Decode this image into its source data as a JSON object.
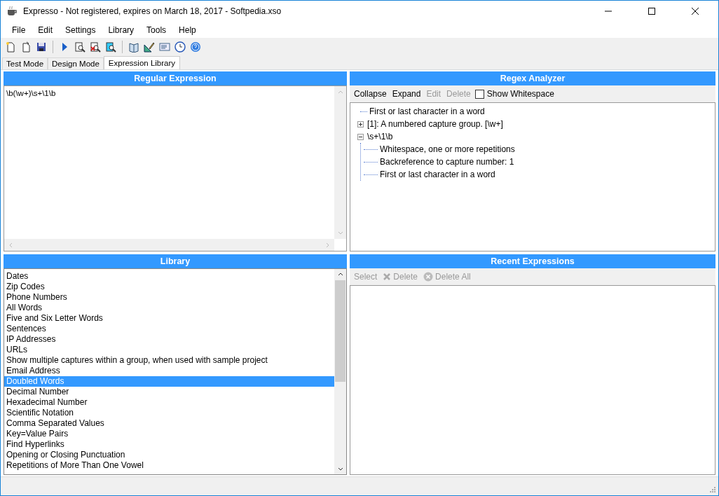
{
  "window": {
    "title": "Expresso - Not registered, expires on March 18, 2017 - Softpedia.xso"
  },
  "menu": [
    "File",
    "Edit",
    "Settings",
    "Library",
    "Tools",
    "Help"
  ],
  "tabs": [
    {
      "label": "Test Mode",
      "selected": false
    },
    {
      "label": "Design Mode",
      "selected": false
    },
    {
      "label": "Expression Library",
      "selected": true
    }
  ],
  "regular_expression": {
    "title": "Regular Expression",
    "value": "\\b(\\w+)\\s+\\1\\b"
  },
  "regex_analyzer": {
    "title": "Regex Analyzer",
    "toolbar": [
      {
        "label": "Collapse",
        "disabled": false
      },
      {
        "label": "Expand",
        "disabled": false
      },
      {
        "label": "Edit",
        "disabled": true
      },
      {
        "label": "Delete",
        "disabled": true
      }
    ],
    "show_whitespace": {
      "label": "Show Whitespace",
      "checked": false
    },
    "tree": [
      {
        "label": "First or last character in a word"
      },
      {
        "label": "[1]: A numbered capture group. [\\w+]",
        "expanded": false
      },
      {
        "label": "\\s+\\1\\b",
        "expanded": true,
        "children": [
          {
            "label": "Whitespace, one or more repetitions"
          },
          {
            "label": "Backreference to capture number: 1"
          },
          {
            "label": "First or last character in a word"
          }
        ]
      }
    ]
  },
  "library": {
    "title": "Library",
    "items": [
      {
        "label": "Dates",
        "selected": false
      },
      {
        "label": "Zip Codes",
        "selected": false
      },
      {
        "label": "Phone Numbers",
        "selected": false
      },
      {
        "label": "All Words",
        "selected": false
      },
      {
        "label": "Five and Six Letter Words",
        "selected": false
      },
      {
        "label": "Sentences",
        "selected": false
      },
      {
        "label": "IP Addresses",
        "selected": false
      },
      {
        "label": "URLs",
        "selected": false
      },
      {
        "label": "Show multiple captures within a group, when used with sample project",
        "selected": false
      },
      {
        "label": "Email Address",
        "selected": false
      },
      {
        "label": "Doubled Words",
        "selected": true
      },
      {
        "label": "Decimal Number",
        "selected": false
      },
      {
        "label": "Hexadecimal Number",
        "selected": false
      },
      {
        "label": "Scientific Notation",
        "selected": false
      },
      {
        "label": "Comma Separated Values",
        "selected": false
      },
      {
        "label": "Key=Value Pairs",
        "selected": false
      },
      {
        "label": "Find Hyperlinks",
        "selected": false
      },
      {
        "label": "Opening or Closing Punctuation",
        "selected": false
      },
      {
        "label": "Repetitions of More Than One Vowel",
        "selected": false
      }
    ]
  },
  "recent_expressions": {
    "title": "Recent Expressions",
    "toolbar": [
      {
        "label": "Select",
        "kind": "plain",
        "disabled": true
      },
      {
        "label": "Delete",
        "kind": "delete",
        "disabled": true
      },
      {
        "label": "Delete All",
        "kind": "delete-all",
        "disabled": true
      }
    ]
  }
}
